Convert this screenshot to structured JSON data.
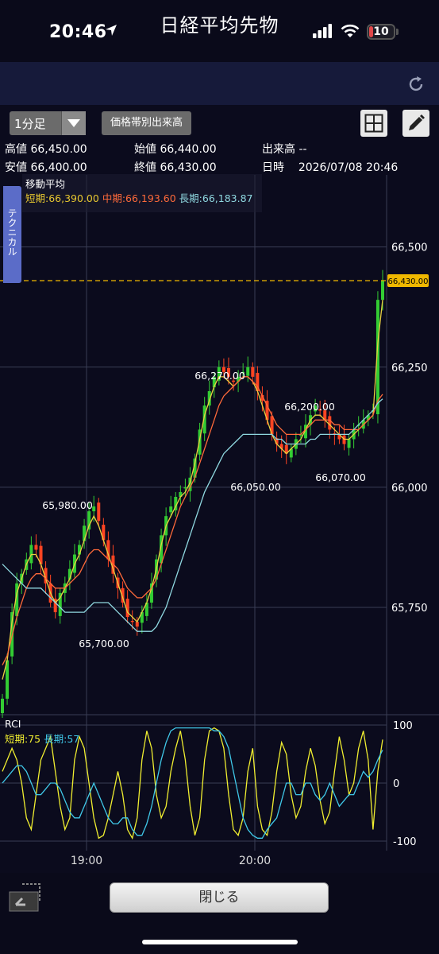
{
  "status_bar": {
    "time": "20:46",
    "battery": "10"
  },
  "title": "日経平均先物",
  "controls": {
    "timeframe": "1分足",
    "volume_profile": "価格帯別出来高"
  },
  "info": {
    "high_label": "高値",
    "high": "66,450.00",
    "open_label": "始値",
    "open": "66,440.00",
    "volume_label": "出来高",
    "volume": "--",
    "low_label": "安値",
    "low": "66,400.00",
    "close_label": "終値",
    "close": "66,430.00",
    "datetime_label": "日時",
    "datetime": "2026/07/08 20:46"
  },
  "side_tab": "テクニカル",
  "ma_legend": {
    "title": "移動平均",
    "short_label": "短期:",
    "short": "66,390.00",
    "mid_label": "中期:",
    "mid": "66,193.60",
    "long_label": "長期:",
    "long": "66,183.87"
  },
  "rci_legend": {
    "title": "RCI",
    "short_label": "短期:",
    "short": "75",
    "long_label": "長期:",
    "long": "57"
  },
  "bottom": {
    "close_button": "閉じる"
  },
  "colors": {
    "background": "#0b0b1d",
    "up_candle": "#33cc33",
    "down_candle": "#ff4422",
    "ma_short": "#e8d040",
    "ma_mid": "#ff6a3a",
    "ma_long": "#8fd8e0",
    "rci_short": "#f0ee30",
    "rci_long": "#40c8e8",
    "last_price": "#f0b800",
    "titlebar": "#161a3a"
  },
  "chart_data": [
    {
      "type": "candlestick",
      "title": "日経平均先物",
      "interval": "1分足",
      "x_ticks": [
        "19:00",
        "20:00"
      ],
      "y_ticks": [
        "66,500",
        "66,250",
        "66,000",
        "65,750"
      ],
      "ylim": [
        65530,
        66650
      ],
      "grid": true,
      "last_price": 66430,
      "last_price_label": "66,430.00",
      "annotations": [
        {
          "label": "65,980.00",
          "value": 65980
        },
        {
          "label": "65,700.00",
          "value": 65700
        },
        {
          "label": "66,270.00",
          "value": 66270
        },
        {
          "label": "66,050.00",
          "value": 66050
        },
        {
          "label": "66,200.00",
          "value": 66200
        },
        {
          "label": "66,070.00",
          "value": 66070
        }
      ],
      "close_path": [
        65560,
        65640,
        65740,
        65800,
        65820,
        65850,
        65880,
        65870,
        65840,
        65800,
        65760,
        65740,
        65780,
        65800,
        65830,
        65860,
        65880,
        65920,
        65950,
        65960,
        65930,
        65890,
        65850,
        65820,
        65790,
        65760,
        65730,
        65720,
        65710,
        65740,
        65760,
        65800,
        65850,
        65900,
        65940,
        65960,
        65980,
        65990,
        66000,
        66020,
        66060,
        66120,
        66170,
        66200,
        66230,
        66250,
        66240,
        66230,
        66220,
        66230,
        66240,
        66250,
        66230,
        66200,
        66180,
        66140,
        66110,
        66090,
        66080,
        66070,
        66080,
        66100,
        66110,
        66130,
        66150,
        66170,
        66160,
        66140,
        66120,
        66110,
        66100,
        66090,
        66100,
        66120,
        66130,
        66140,
        66150,
        66160,
        66390,
        66430
      ],
      "series": [
        {
          "name": "短期",
          "values": [
            65600,
            65640,
            65720,
            65780,
            65810,
            65840,
            65860,
            65860,
            65840,
            65810,
            65780,
            65760,
            65770,
            65790,
            65810,
            65840,
            65860,
            65890,
            65920,
            65940,
            65920,
            65890,
            65860,
            65830,
            65800,
            65770,
            65740,
            65730,
            65720,
            65740,
            65760,
            65790,
            65830,
            65880,
            65920,
            65940,
            65960,
            65980,
            65990,
            66010,
            66050,
            66100,
            66150,
            66180,
            66210,
            66230,
            66230,
            66220,
            66210,
            66220,
            66230,
            66230,
            66220,
            66200,
            66170,
            66140,
            66110,
            66090,
            66080,
            66070,
            66080,
            66090,
            66100,
            66120,
            66140,
            66150,
            66150,
            66140,
            66130,
            66120,
            66110,
            66100,
            66100,
            66110,
            66120,
            66130,
            66140,
            66150,
            66300,
            66390
          ]
        },
        {
          "name": "中期",
          "values": [
            65630,
            65650,
            65690,
            65730,
            65760,
            65790,
            65810,
            65820,
            65820,
            65810,
            65800,
            65790,
            65790,
            65790,
            65800,
            65810,
            65820,
            65840,
            65860,
            65870,
            65870,
            65860,
            65850,
            65840,
            65830,
            65810,
            65790,
            65780,
            65770,
            65770,
            65780,
            65790,
            65810,
            65840,
            65870,
            65900,
            65930,
            65960,
            65980,
            66000,
            66020,
            66050,
            66080,
            66110,
            66140,
            66170,
            66190,
            66200,
            66210,
            66220,
            66230,
            66230,
            66220,
            66210,
            66190,
            66170,
            66150,
            66130,
            66120,
            66110,
            66110,
            66110,
            66110,
            66120,
            66130,
            66140,
            66140,
            66140,
            66140,
            66130,
            66130,
            66120,
            66120,
            66120,
            66120,
            66130,
            66140,
            66150,
            66180,
            66193.6
          ]
        },
        {
          "name": "長期",
          "values": [
            65840,
            65830,
            65820,
            65810,
            65800,
            65790,
            65790,
            65790,
            65790,
            65780,
            65770,
            65760,
            65750,
            65740,
            65740,
            65740,
            65740,
            65740,
            65750,
            65760,
            65760,
            65760,
            65760,
            65750,
            65740,
            65730,
            65720,
            65710,
            65700,
            65700,
            65700,
            65700,
            65710,
            65730,
            65750,
            65780,
            65810,
            65840,
            65870,
            65900,
            65930,
            65960,
            65990,
            66010,
            66030,
            66050,
            66070,
            66080,
            66090,
            66100,
            66110,
            66110,
            66110,
            66110,
            66110,
            66110,
            66110,
            66100,
            66100,
            66090,
            66090,
            66090,
            66090,
            66090,
            66100,
            66100,
            66110,
            66110,
            66110,
            66110,
            66110,
            66110,
            66110,
            66120,
            66130,
            66140,
            66150,
            66160,
            66175,
            66183.87
          ]
        }
      ]
    },
    {
      "type": "line",
      "title": "RCI",
      "y_ticks": [
        "100",
        "0",
        "-100"
      ],
      "ylim": [
        -100,
        100
      ],
      "grid": true,
      "series": [
        {
          "name": "短期",
          "values": [
            20,
            40,
            60,
            40,
            0,
            -60,
            -80,
            -20,
            40,
            60,
            80,
            20,
            -40,
            -80,
            -60,
            40,
            80,
            60,
            0,
            -60,
            -95,
            -90,
            -60,
            -20,
            20,
            -20,
            -80,
            -95,
            -60,
            40,
            90,
            60,
            -20,
            -60,
            -40,
            20,
            60,
            90,
            40,
            -40,
            -90,
            -60,
            40,
            90,
            95,
            90,
            60,
            -20,
            -80,
            -90,
            -60,
            20,
            60,
            -40,
            -80,
            -90,
            -50,
            20,
            70,
            50,
            -20,
            -60,
            -40,
            20,
            60,
            30,
            -30,
            -70,
            -50,
            20,
            80,
            40,
            -20,
            0,
            60,
            90,
            40,
            -80,
            20,
            75
          ]
        },
        {
          "name": "長期",
          "values": [
            0,
            10,
            20,
            30,
            30,
            20,
            0,
            -20,
            -20,
            -10,
            0,
            0,
            -10,
            -30,
            -50,
            -60,
            -60,
            -40,
            -20,
            0,
            -20,
            -40,
            -60,
            -70,
            -70,
            -60,
            -60,
            -80,
            -90,
            -90,
            -70,
            -40,
            0,
            40,
            70,
            90,
            95,
            95,
            95,
            95,
            95,
            95,
            95,
            95,
            90,
            90,
            80,
            60,
            20,
            -20,
            -60,
            -80,
            -90,
            -95,
            -95,
            -80,
            -70,
            -60,
            -30,
            0,
            0,
            -20,
            -20,
            0,
            0,
            -20,
            -30,
            -20,
            0,
            -20,
            -40,
            -30,
            -20,
            -20,
            0,
            20,
            10,
            20,
            40,
            57
          ]
        }
      ]
    }
  ]
}
